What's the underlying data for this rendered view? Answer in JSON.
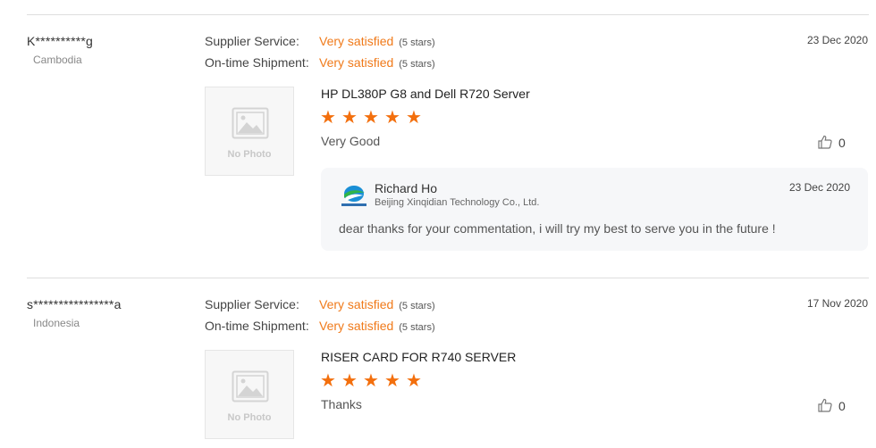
{
  "reviews": [
    {
      "buyer": "K**********g",
      "country": "Cambodia",
      "date": "23 Dec 2020",
      "ratings": [
        {
          "label": "Supplier Service:",
          "value": "Very satisfied",
          "stars": "(5 stars)"
        },
        {
          "label": "On-time Shipment:",
          "value": "Very satisfied",
          "stars": "(5 stars)"
        }
      ],
      "photo_text": "No Photo",
      "product": "HP DL380P G8 and Dell R720 Server",
      "rating": 5,
      "comment": "Very Good",
      "likes": "0",
      "reply": {
        "name": "Richard Ho",
        "company": "Beijing Xinqidian Technology Co., Ltd.",
        "date": "23 Dec 2020",
        "text": "dear thanks for your commentation, i will try my best to serve you in the future !"
      }
    },
    {
      "buyer": "s****************a",
      "country": "Indonesia",
      "date": "17 Nov 2020",
      "ratings": [
        {
          "label": "Supplier Service:",
          "value": "Very satisfied",
          "stars": "(5 stars)"
        },
        {
          "label": "On-time Shipment:",
          "value": "Very satisfied",
          "stars": "(5 stars)"
        }
      ],
      "photo_text": "No Photo",
      "product": "RISER CARD FOR R740 SERVER",
      "rating": 5,
      "comment": "Thanks",
      "likes": "0"
    }
  ],
  "colors": {
    "accent": "#f07a1a",
    "star": "#f36f0d",
    "divider": "#dedede"
  },
  "icons": {
    "photo": "image-placeholder-icon",
    "like": "thumbs-up-icon",
    "star": "star-icon",
    "logo": "company-logo"
  }
}
